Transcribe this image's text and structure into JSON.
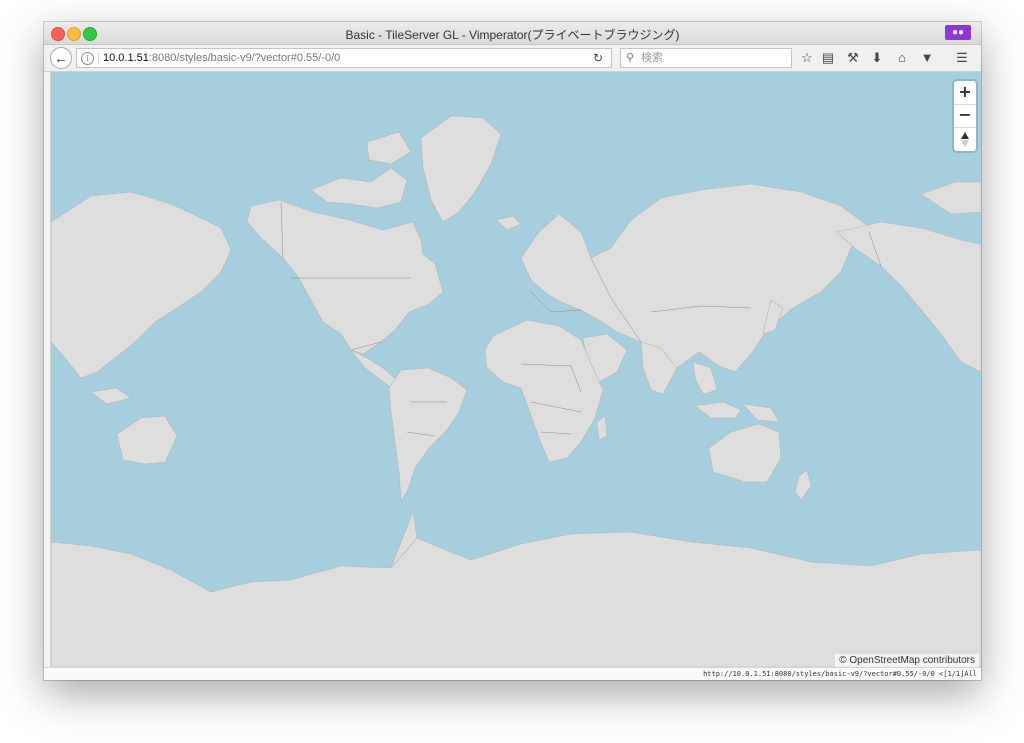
{
  "window": {
    "title": "Basic - TileServer GL - Vimperator(プライベートブラウジング)",
    "private_icon": "mask-icon"
  },
  "navbar": {
    "url_host": "10.0.1.51",
    "url_rest": ":8080/styles/basic-v9/?vector#0.55/-0/0",
    "search_placeholder": "検索",
    "icons": [
      "back-arrow-icon",
      "info-icon",
      "reload-icon",
      "search-icon",
      "bookmark-star-icon",
      "reading-list-icon",
      "wrench-icon",
      "download-icon",
      "home-icon",
      "pocket-icon",
      "hamburger-menu-icon"
    ]
  },
  "map": {
    "zoom_in_label": "+",
    "zoom_out_label": "−",
    "compass_icon": "compass-icon",
    "attribution": "© OpenStreetMap contributors",
    "colors": {
      "water": "#a5cfde",
      "land": "#dedede",
      "boundary": "#8c8c8c"
    }
  },
  "statusbar": {
    "text": "http://10.0.1.51:8080/styles/basic-v9/?vector#0.55/-0/0 <[1/1]All"
  }
}
